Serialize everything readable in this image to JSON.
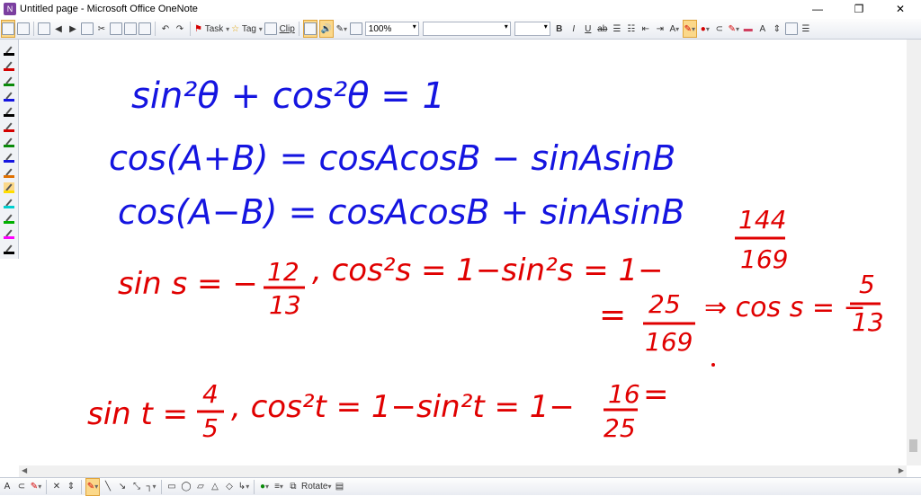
{
  "window": {
    "title": "Untitled page - Microsoft Office OneNote",
    "app_icon_letter": "N",
    "controls": [
      "—",
      "❐",
      "✕"
    ]
  },
  "toolbar": {
    "task_label": "Task",
    "tag_label": "Tag",
    "clip_label": "Clip",
    "zoom_value": "100%",
    "font_value": "",
    "size_value": ""
  },
  "bottom_toolbar": {
    "rotate_label": "Rotate"
  },
  "colors": {
    "ink_blue": "#1515e0",
    "ink_red": "#e00000",
    "highlight": "#fbd88a"
  },
  "pen_colors": [
    "#000000",
    "#d40000",
    "#0a8a0a",
    "#1515e0",
    "#000000",
    "#d40000",
    "#0a8a0a",
    "#1515e0",
    "#e07000",
    "#ffdd00",
    "#00d0d0",
    "#00b000",
    "#ff00ff",
    "#000000"
  ],
  "notes": {
    "line1": "sin²θ + cos²θ = 1",
    "line2": "cos(A+B) = cosAcosB − sinAsinB",
    "line3": "cos(A−B) = cosAcosB + sinAsinB",
    "line4_a": "sin s = −",
    "line4_num": "12",
    "line4_den": "13",
    "line4_b": ", cos²s = 1−sin²s = 1−",
    "line4_num2": "144",
    "line4_den2": "169",
    "line5_a": "=",
    "line5_num": "25",
    "line5_den": "169",
    "line5_b": "⇒ cos s = −",
    "line5_num2": "5",
    "line5_den2": "13",
    "line6_a": "sin t =",
    "line6_num": "4",
    "line6_den": "5",
    "line6_b": ", cos²t = 1−sin²t = 1−",
    "line6_num2": "16",
    "line6_den2": "25",
    "line6_c": "="
  }
}
